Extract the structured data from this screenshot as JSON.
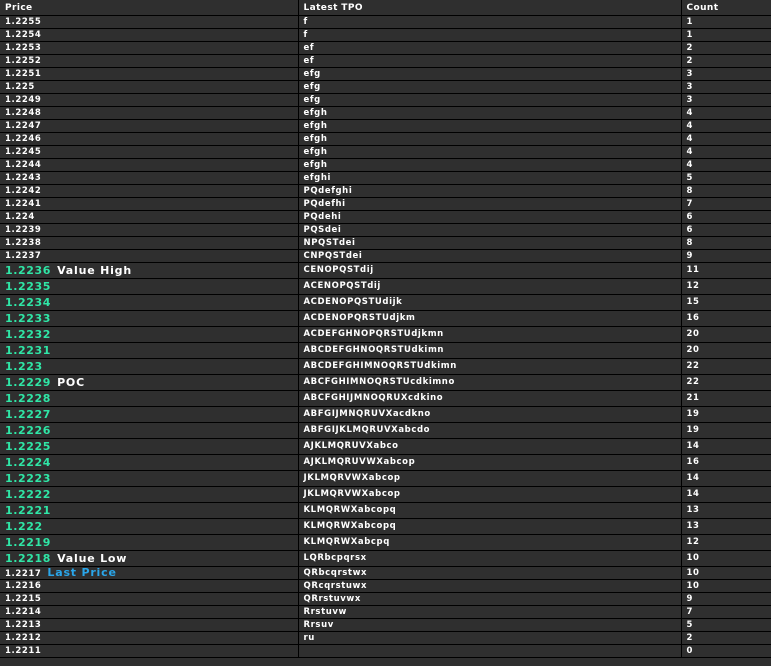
{
  "table": {
    "headers": {
      "price": "Price",
      "letters": "Latest TPO",
      "count": "Count"
    },
    "rows": [
      {
        "price": "1.2255",
        "letters": "f",
        "count": "1",
        "tag": "",
        "value_area": false
      },
      {
        "price": "1.2254",
        "letters": "f",
        "count": "1",
        "tag": "",
        "value_area": false
      },
      {
        "price": "1.2253",
        "letters": "ef",
        "count": "2",
        "tag": "",
        "value_area": false
      },
      {
        "price": "1.2252",
        "letters": "ef",
        "count": "2",
        "tag": "",
        "value_area": false
      },
      {
        "price": "1.2251",
        "letters": "efg",
        "count": "3",
        "tag": "",
        "value_area": false
      },
      {
        "price": "1.225",
        "letters": "efg",
        "count": "3",
        "tag": "",
        "value_area": false
      },
      {
        "price": "1.2249",
        "letters": "efg",
        "count": "3",
        "tag": "",
        "value_area": false
      },
      {
        "price": "1.2248",
        "letters": "efgh",
        "count": "4",
        "tag": "",
        "value_area": false
      },
      {
        "price": "1.2247",
        "letters": "efgh",
        "count": "4",
        "tag": "",
        "value_area": false
      },
      {
        "price": "1.2246",
        "letters": "efgh",
        "count": "4",
        "tag": "",
        "value_area": false
      },
      {
        "price": "1.2245",
        "letters": "efgh",
        "count": "4",
        "tag": "",
        "value_area": false
      },
      {
        "price": "1.2244",
        "letters": "efgh",
        "count": "4",
        "tag": "",
        "value_area": false
      },
      {
        "price": "1.2243",
        "letters": "efghi",
        "count": "5",
        "tag": "",
        "value_area": false
      },
      {
        "price": "1.2242",
        "letters": "PQdefghi",
        "count": "8",
        "tag": "",
        "value_area": false
      },
      {
        "price": "1.2241",
        "letters": "PQdefhi",
        "count": "7",
        "tag": "",
        "value_area": false
      },
      {
        "price": "1.224",
        "letters": "PQdehi",
        "count": "6",
        "tag": "",
        "value_area": false
      },
      {
        "price": "1.2239",
        "letters": "PQSdei",
        "count": "6",
        "tag": "",
        "value_area": false
      },
      {
        "price": "1.2238",
        "letters": "NPQSTdei",
        "count": "8",
        "tag": "",
        "value_area": false
      },
      {
        "price": "1.2237",
        "letters": "CNPQSTdei",
        "count": "9",
        "tag": "",
        "value_area": false
      },
      {
        "price": "1.2236",
        "letters": "CENOPQSTdij",
        "count": "11",
        "tag": "Value High",
        "value_area": true
      },
      {
        "price": "1.2235",
        "letters": "ACENOPQSTdij",
        "count": "12",
        "tag": "",
        "value_area": true
      },
      {
        "price": "1.2234",
        "letters": "ACDENOPQSTUdijk",
        "count": "15",
        "tag": "",
        "value_area": true
      },
      {
        "price": "1.2233",
        "letters": "ACDENOPQRSTUdjkm",
        "count": "16",
        "tag": "",
        "value_area": true
      },
      {
        "price": "1.2232",
        "letters": "ACDEFGHNOPQRSTUdjkmn",
        "count": "20",
        "tag": "",
        "value_area": true
      },
      {
        "price": "1.2231",
        "letters": "ABCDEFGHNOQRSTUdkimn",
        "count": "20",
        "tag": "",
        "value_area": true
      },
      {
        "price": "1.223",
        "letters": "ABCDEFGHIMNOQRSTUdkimn",
        "count": "22",
        "tag": "",
        "value_area": true
      },
      {
        "price": "1.2229",
        "letters": "ABCFGHIMNOQRSTUcdkimno",
        "count": "22",
        "tag": "POC",
        "value_area": true
      },
      {
        "price": "1.2228",
        "letters": "ABCFGHIJMNOQRUXcdkino",
        "count": "21",
        "tag": "",
        "value_area": true
      },
      {
        "price": "1.2227",
        "letters": "ABFGIJMNQRUVXacdkno",
        "count": "19",
        "tag": "",
        "value_area": true
      },
      {
        "price": "1.2226",
        "letters": "ABFGIJKLMQRUVXabcdo",
        "count": "19",
        "tag": "",
        "value_area": true
      },
      {
        "price": "1.2225",
        "letters": "AJKLMQRUVXabco",
        "count": "14",
        "tag": "",
        "value_area": true
      },
      {
        "price": "1.2224",
        "letters": "AJKLMQRUVWXabcop",
        "count": "16",
        "tag": "",
        "value_area": true
      },
      {
        "price": "1.2223",
        "letters": "JKLMQRVWXabcop",
        "count": "14",
        "tag": "",
        "value_area": true
      },
      {
        "price": "1.2222",
        "letters": "JKLMQRVWXabcop",
        "count": "14",
        "tag": "",
        "value_area": true
      },
      {
        "price": "1.2221",
        "letters": "KLMQRWXabcopq",
        "count": "13",
        "tag": "",
        "value_area": true
      },
      {
        "price": "1.222",
        "letters": "KLMQRWXabcopq",
        "count": "13",
        "tag": "",
        "value_area": true
      },
      {
        "price": "1.2219",
        "letters": "KLMQRWXabcpq",
        "count": "12",
        "tag": "",
        "value_area": true
      },
      {
        "price": "1.2218",
        "letters": "LQRbcpqrsx",
        "count": "10",
        "tag": "Value Low",
        "value_area": true
      },
      {
        "price": "1.2217",
        "letters": "QRbcqrstwx",
        "count": "10",
        "tag": "Last Price",
        "value_area": false
      },
      {
        "price": "1.2216",
        "letters": "QRcqrstuwx",
        "count": "10",
        "tag": "",
        "value_area": false
      },
      {
        "price": "1.2215",
        "letters": "QRrstuvwx",
        "count": "9",
        "tag": "",
        "value_area": false
      },
      {
        "price": "1.2214",
        "letters": "Rrstuvw",
        "count": "7",
        "tag": "",
        "value_area": false
      },
      {
        "price": "1.2213",
        "letters": "Rrsuv",
        "count": "5",
        "tag": "",
        "value_area": false
      },
      {
        "price": "1.2212",
        "letters": "ru",
        "count": "2",
        "tag": "",
        "value_area": false
      },
      {
        "price": "1.2211",
        "letters": "",
        "count": "0",
        "tag": "",
        "value_area": false
      }
    ]
  },
  "colors": {
    "background": "#2f2f2f",
    "grid": "#000000",
    "text": "#ffffff",
    "value_area_price": "#2fe6a6",
    "last_price_tag": "#2aa6ea",
    "accent": "#34b4e8"
  }
}
